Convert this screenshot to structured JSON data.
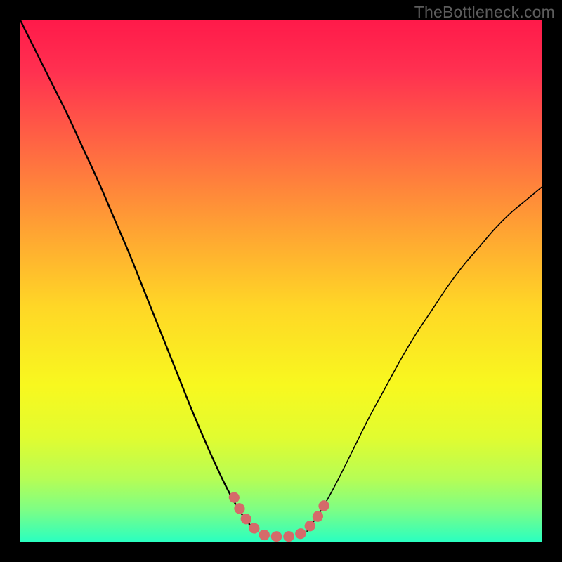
{
  "watermark": "TheBottleneck.com",
  "chart_data": {
    "type": "line",
    "title": "",
    "xlabel": "",
    "ylabel": "",
    "xlim": [
      0,
      100
    ],
    "ylim": [
      0,
      100
    ],
    "series": [
      {
        "name": "left-curve",
        "x": [
          0,
          3,
          6,
          9,
          12,
          15,
          18,
          21,
          24,
          27,
          30,
          33,
          36,
          39,
          42,
          45
        ],
        "values": [
          100,
          94,
          88,
          82,
          75.5,
          69,
          62,
          55,
          47.5,
          40,
          32.5,
          25,
          18,
          11.5,
          6,
          2
        ]
      },
      {
        "name": "right-curve",
        "x": [
          55,
          58,
          61,
          64,
          67,
          70,
          73,
          76,
          79,
          82,
          85,
          88,
          91,
          94,
          97,
          100
        ],
        "values": [
          2,
          6.5,
          12,
          18,
          24,
          29.5,
          35,
          40,
          44.5,
          49,
          53,
          56.5,
          60,
          63,
          65.5,
          68
        ]
      },
      {
        "name": "pink-u-segment",
        "x": [
          41,
          42.5,
          44,
          45.5,
          47,
          48.5,
          50,
          51.5,
          53,
          54.5,
          56,
          57.5,
          59
        ],
        "values": [
          8.5,
          5.5,
          3.5,
          2,
          1.2,
          1,
          1,
          1,
          1.2,
          2,
          3.5,
          5.5,
          8.5
        ]
      }
    ],
    "gradient_stops": [
      {
        "pos": 0.0,
        "color": "#ff1a4a"
      },
      {
        "pos": 0.1,
        "color": "#ff3150"
      },
      {
        "pos": 0.25,
        "color": "#ff6a42"
      },
      {
        "pos": 0.4,
        "color": "#ffa233"
      },
      {
        "pos": 0.55,
        "color": "#ffd726"
      },
      {
        "pos": 0.7,
        "color": "#f8f81f"
      },
      {
        "pos": 0.8,
        "color": "#e1fc30"
      },
      {
        "pos": 0.88,
        "color": "#b6fd55"
      },
      {
        "pos": 0.94,
        "color": "#7cfe86"
      },
      {
        "pos": 1.0,
        "color": "#2affc0"
      }
    ],
    "colors": {
      "curve": "#000000",
      "pink_segment": "#d56a6a"
    }
  }
}
